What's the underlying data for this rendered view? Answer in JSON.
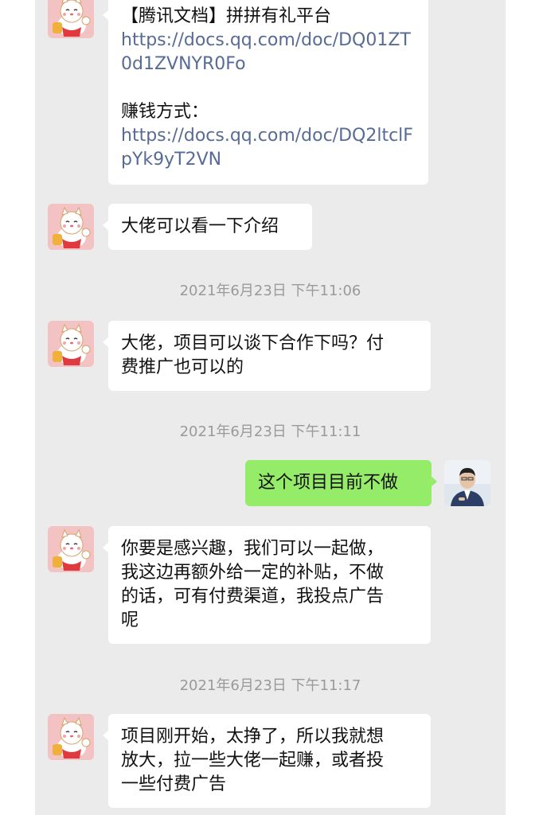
{
  "messages": [
    {
      "title": "【腾讯文档】拼拼有礼平台",
      "link1": "https://docs.qq.com/doc/DQ01ZT0d1ZVNYR0Fo",
      "link1_line1": "https://docs.qq.com/doc/DQ01ZT",
      "link1_line2": "0d1ZVNYR0Fo",
      "subtitle": "赚钱方式：",
      "link2_line1": "https://docs.qq.com/doc/DQ2ltclF",
      "link2_line2": "pYk9yT2VN"
    },
    {
      "text": "大佬可以看一下介绍"
    },
    {
      "line1": "大佬，项目可以谈下合作下吗？付",
      "line2": "费推广也可以的"
    },
    {
      "text": "这个项目目前不做"
    },
    {
      "line1": "你要是感兴趣，我们可以一起做，",
      "line2": "我这边再额外给一定的补贴，不做",
      "line3": "的话，可有付费渠道，我投点广告",
      "line4": "呢"
    },
    {
      "line1": "项目刚开始，太挣了，所以我就想",
      "line2": "放大，拉一些大佬一起赚，或者投",
      "line3": "一些付费广告"
    }
  ],
  "timestamps": [
    "2021年6月23日 下午11:06",
    "2021年6月23日 下午11:11",
    "2021年6月23日 下午11:17"
  ],
  "colors": {
    "background": "#ebebeb",
    "incoming_bubble": "#ffffff",
    "outgoing_bubble": "#95ec69",
    "link": "#576b95",
    "timestamp": "#9a9a9a"
  },
  "icons": {
    "contact_avatar": "lucky-cat-avatar-icon",
    "self_avatar": "user-photo-avatar-icon"
  }
}
